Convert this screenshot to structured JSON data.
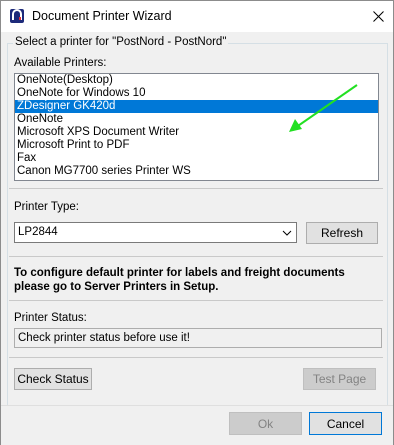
{
  "window": {
    "title": "Document Printer Wizard",
    "app_icon": "app-logo-icon",
    "close_icon": "close-icon"
  },
  "group": {
    "legend": "Select a printer for \"PostNord - PostNord\""
  },
  "printers": {
    "label": "Available Printers:",
    "items": [
      "OneNote(Desktop)",
      "OneNote for Windows 10",
      "ZDesigner GK420d",
      "OneNote",
      "Microsoft XPS Document Writer",
      "Microsoft Print to PDF",
      "Fax",
      "Canon MG7700 series Printer WS"
    ],
    "selected": "ZDesigner GK420d"
  },
  "printer_type": {
    "label": "Printer Type:",
    "value": "LP2844",
    "refresh_label": "Refresh"
  },
  "info": {
    "text": "To configure default printer for labels and freight documents please go to Server Printers in Setup."
  },
  "status": {
    "label": "Printer Status:",
    "value": "Check printer status before use it!",
    "check_label": "Check Status",
    "test_label": "Test Page"
  },
  "footer": {
    "ok_label": "Ok",
    "cancel_label": "Cancel"
  },
  "colors": {
    "selection": "#0078d7",
    "annotation_arrow": "#22e022"
  }
}
